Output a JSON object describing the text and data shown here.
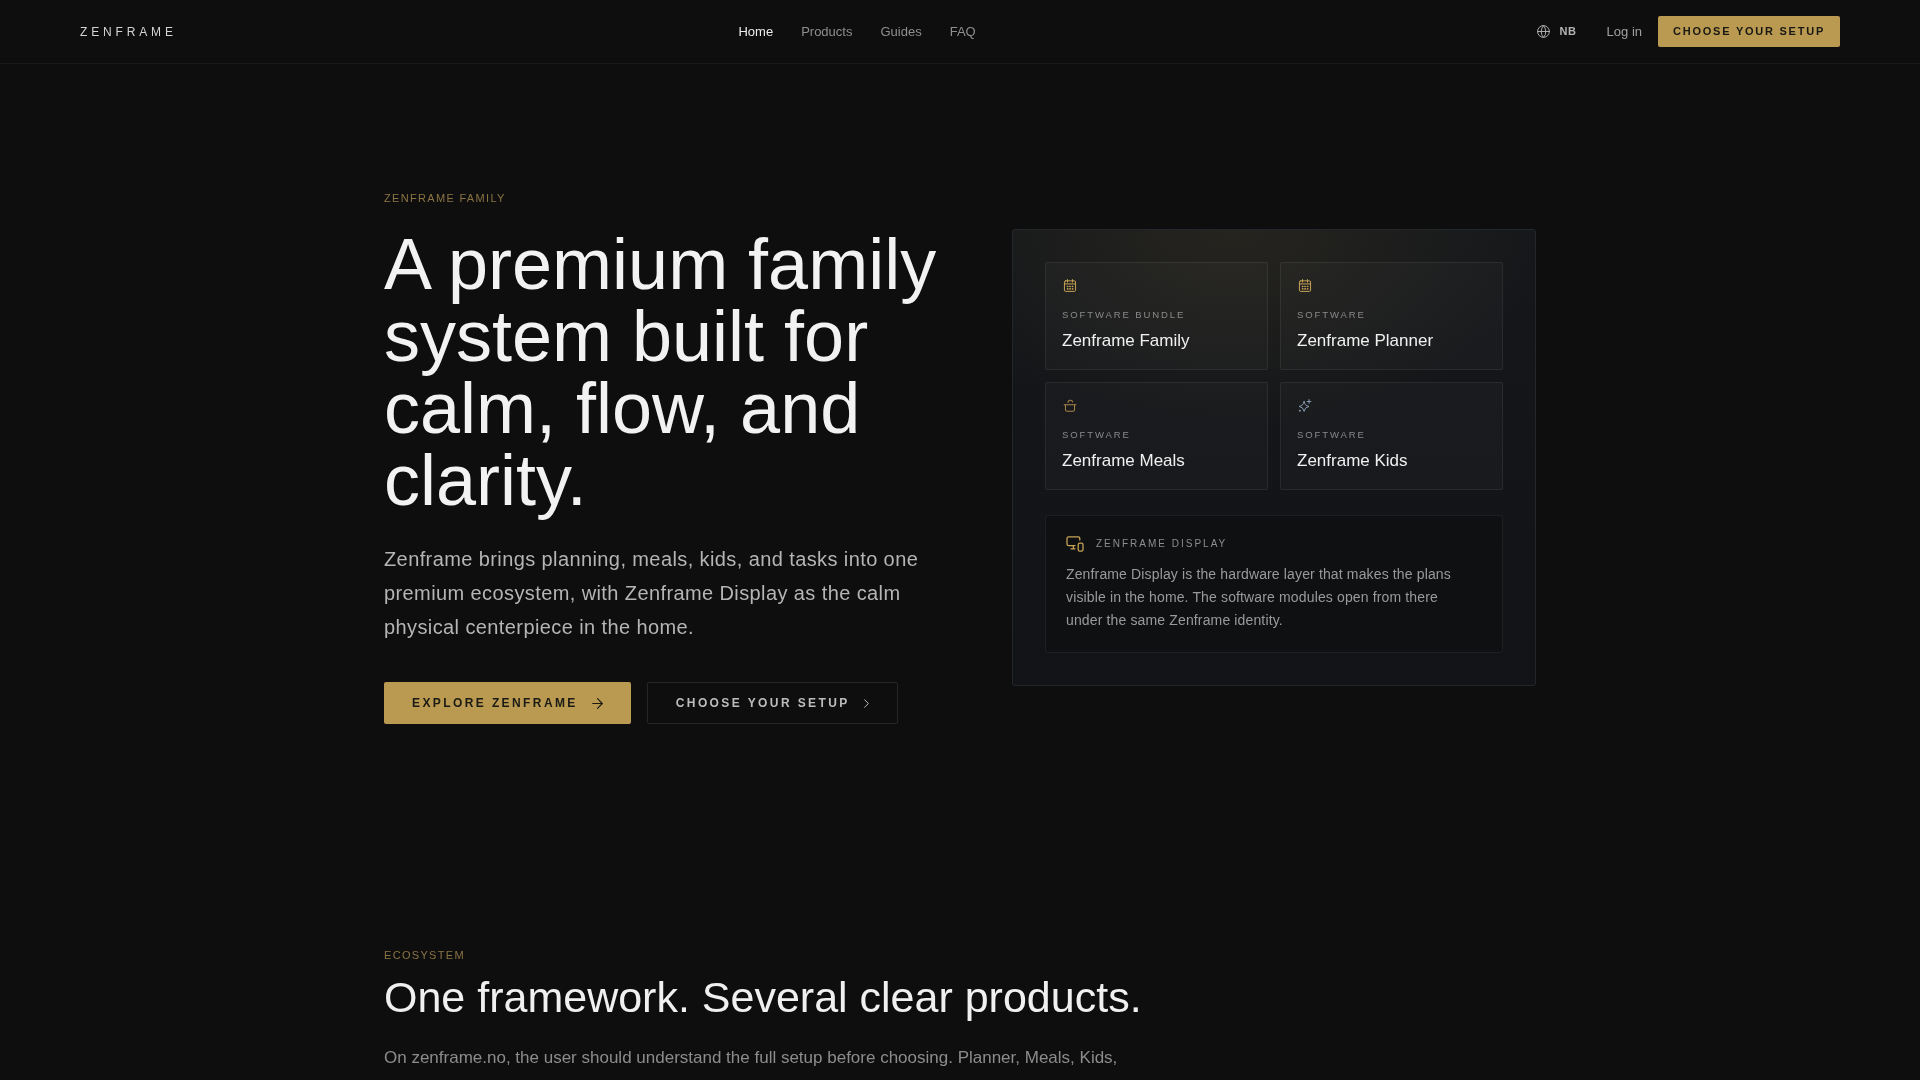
{
  "header": {
    "logo": "ZENFRAME",
    "nav": [
      {
        "label": "Home",
        "selected": true
      },
      {
        "label": "Products",
        "selected": false
      },
      {
        "label": "Guides",
        "selected": false
      },
      {
        "label": "FAQ",
        "selected": false
      }
    ],
    "language": "NB",
    "login": "Log in",
    "cta": "CHOOSE YOUR SETUP"
  },
  "hero": {
    "eyebrow": "ZENFRAME FAMILY",
    "title": "A premium family system built for calm, flow, and clarity.",
    "description": "Zenframe brings planning, meals, kids, and tasks into one premium ecosystem, with Zenframe Display as the calm physical centerpiece in the home.",
    "buttons": [
      {
        "label": "EXPLORE ZENFRAME",
        "kind": "primary"
      },
      {
        "label": "CHOOSE YOUR SETUP",
        "kind": "secondary"
      }
    ]
  },
  "product_panel": {
    "products": [
      {
        "category": "SOFTWARE BUNDLE",
        "name": "Zenframe Family"
      },
      {
        "category": "SOFTWARE",
        "name": "Zenframe Planner"
      },
      {
        "category": "SOFTWARE",
        "name": "Zenframe Meals"
      },
      {
        "category": "SOFTWARE",
        "name": "Zenframe Kids"
      }
    ],
    "display": {
      "label": "ZENFRAME DISPLAY",
      "description": "Zenframe Display is the hardware layer that makes the plans visible in the home. The software modules open from there under the same Zenframe identity."
    }
  },
  "ecosystem": {
    "eyebrow": "ECOSYSTEM",
    "title": "One framework. Several clear products.",
    "intro": "On zenframe.no, the user should understand the full setup before choosing. Planner, Meals, Kids,"
  }
}
